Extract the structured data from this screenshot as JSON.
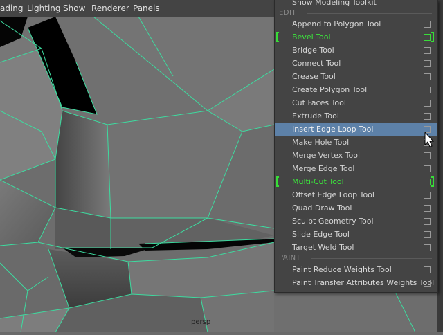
{
  "menubar": {
    "items": [
      "ading",
      "Lighting",
      "Show",
      "Renderer",
      "Panels"
    ]
  },
  "viewport": {
    "camera_label": "persp",
    "wire_color": "#3ddca0"
  },
  "menu": {
    "top_item": "Show Modeling Toolkit",
    "edit_header": "EDIT",
    "paint_header": "PAINT",
    "edit_items": [
      {
        "label": "Append to Polygon Tool",
        "state": "normal"
      },
      {
        "label": "Bevel Tool",
        "state": "selected"
      },
      {
        "label": "Bridge Tool",
        "state": "normal"
      },
      {
        "label": "Connect Tool",
        "state": "normal"
      },
      {
        "label": "Crease Tool",
        "state": "normal"
      },
      {
        "label": "Create Polygon Tool",
        "state": "normal"
      },
      {
        "label": "Cut Faces Tool",
        "state": "normal"
      },
      {
        "label": "Extrude Tool",
        "state": "normal"
      },
      {
        "label": "Insert Edge Loop Tool",
        "state": "highlighted"
      },
      {
        "label": "Make Hole Tool",
        "state": "normal"
      },
      {
        "label": "Merge Vertex Tool",
        "state": "normal"
      },
      {
        "label": "Merge Edge Tool",
        "state": "normal"
      },
      {
        "label": "Multi-Cut Tool",
        "state": "selected"
      },
      {
        "label": "Offset Edge Loop Tool",
        "state": "normal"
      },
      {
        "label": "Quad Draw Tool",
        "state": "normal"
      },
      {
        "label": "Sculpt Geometry Tool",
        "state": "normal"
      },
      {
        "label": "Slide Edge Tool",
        "state": "normal"
      },
      {
        "label": "Target Weld Tool",
        "state": "normal"
      }
    ],
    "paint_items": [
      {
        "label": "Paint Reduce Weights Tool",
        "state": "normal"
      },
      {
        "label": "Paint Transfer Attributes Weights Tool",
        "state": "normal"
      }
    ],
    "colors": {
      "selected": "#3ce63c",
      "highlight": "#5d81a8",
      "background": "#444444"
    }
  }
}
